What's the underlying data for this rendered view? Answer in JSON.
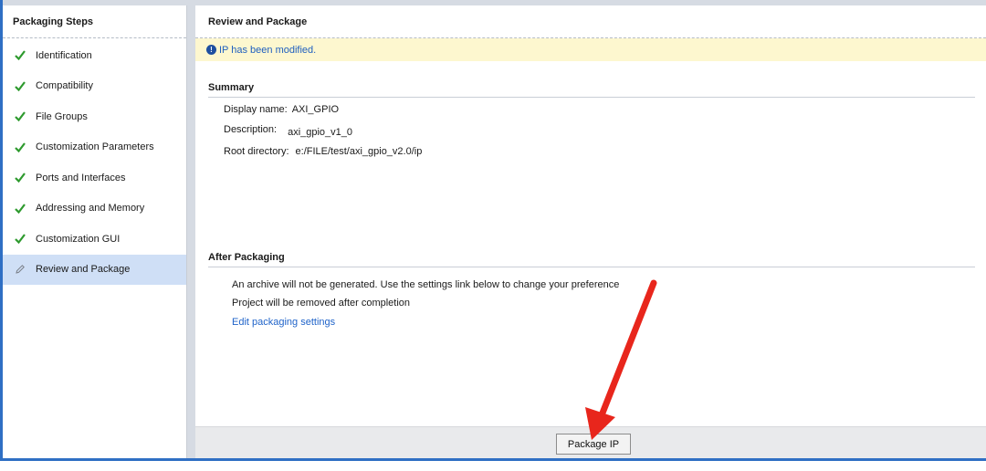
{
  "left_panel": {
    "title": "Packaging Steps",
    "steps": [
      {
        "label": "Identification",
        "status": "done"
      },
      {
        "label": "Compatibility",
        "status": "done"
      },
      {
        "label": "File Groups",
        "status": "done"
      },
      {
        "label": "Customization Parameters",
        "status": "done"
      },
      {
        "label": "Ports and Interfaces",
        "status": "done"
      },
      {
        "label": "Addressing and Memory",
        "status": "done"
      },
      {
        "label": "Customization GUI",
        "status": "done"
      },
      {
        "label": "Review and Package",
        "status": "current"
      }
    ]
  },
  "right_panel": {
    "title": "Review and Package",
    "notice": "IP has been modified.",
    "summary": {
      "heading": "Summary",
      "display_name_label": "Display name:",
      "display_name_value": "AXI_GPIO",
      "description_label": "Description:",
      "description_value": "axi_gpio_v1_0",
      "root_directory_label": "Root directory:",
      "root_directory_value": "e:/FILE/test/axi_gpio_v2.0/ip"
    },
    "after_packaging": {
      "heading": "After Packaging",
      "line1": "An archive will not be generated. Use the settings link below to change your preference",
      "line2": "Project will be removed after completion",
      "link": "Edit packaging settings"
    },
    "package_button": "Package IP"
  },
  "colors": {
    "accent_blue": "#2f6fc4",
    "check_green": "#2e9a2e",
    "selected_row": "#cfdff6",
    "notice_bg": "#fdf7cf",
    "link": "#1f63c9",
    "annotation_arrow": "#e8261c"
  },
  "icons": {
    "done": "check-icon",
    "current": "pencil-icon",
    "notice": "info-icon"
  }
}
